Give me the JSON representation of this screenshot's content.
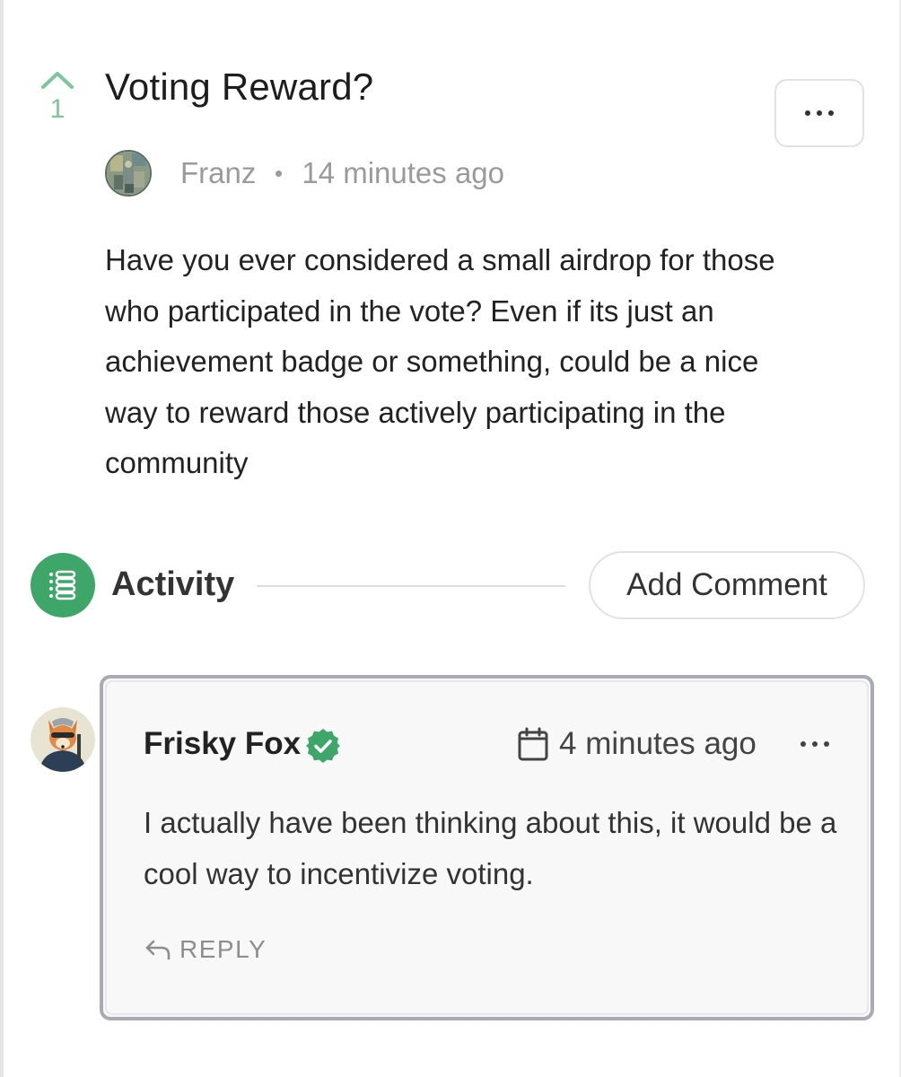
{
  "post": {
    "vote_count": "1",
    "title": "Voting Reward?",
    "author": "Franz",
    "time": "14 minutes ago",
    "body": "Have you ever considered a small airdrop for those who participated in the vote? Even if its just an achievement badge or something, could be a nice way to reward those actively participating in the community"
  },
  "activity": {
    "label": "Activity",
    "add_comment_label": "Add Comment"
  },
  "comment": {
    "author": "Frisky Fox",
    "time": "4 minutes ago",
    "body": "I actually have been thinking about this, it would be a cool way to incentivize voting.",
    "reply_label": "REPLY"
  },
  "icons": {
    "upvote": "chevron-up-icon",
    "more": "more-horizontal-icon",
    "activity": "activity-list-icon",
    "verified": "verified-badge-icon",
    "calendar": "calendar-icon",
    "reply": "reply-arrow-icon"
  },
  "colors": {
    "accent_green": "#3fa66a",
    "vote_green": "#7cc79a",
    "muted_text": "#9a9a9a",
    "card_border": "#a9aab5"
  }
}
